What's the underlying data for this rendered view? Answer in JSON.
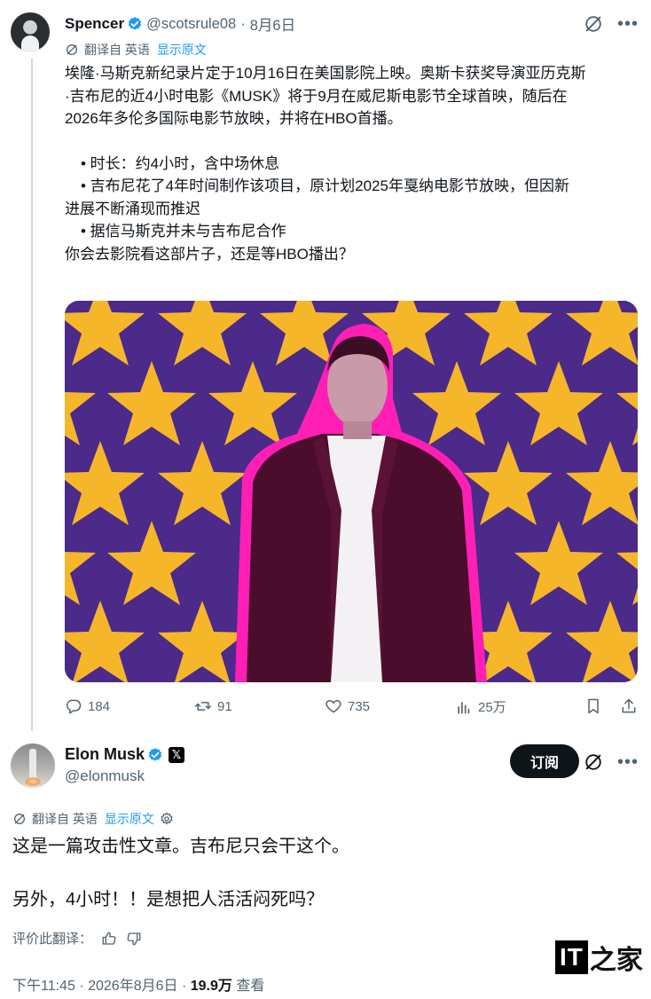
{
  "post1": {
    "name": "Spencer",
    "handle": "@scotsrule08",
    "dot": "·",
    "date": "8月6日",
    "translate_label": "翻译自 英语",
    "show_original": "显示原文",
    "body_lines": [
      "埃隆·马斯克新纪录片定于10月16日在美国影院上映。奥斯卡获奖导演亚历克斯",
      "·吉布尼的近4小时电影《MUSK》将于9月在威尼斯电影节全球首映，随后在",
      "2026年多伦多国际电影节放映，并将在HBO首播。"
    ],
    "bullets": [
      "• 时长：约4小时，含中场休息",
      "• 吉布尼花了4年时间制作该项目，原计划2025年戛纳电影节放映，但因新",
      "进展不断涌现而推迟",
      "• 据信马斯克并未与吉布尼合作"
    ],
    "question": "你会去影院看这部片子，还是等HBO播出？",
    "replies": "184",
    "reposts": "91",
    "likes": "735",
    "views": "25万"
  },
  "post2": {
    "name": "Elon Musk",
    "x_badge": "𝕏",
    "handle": "@elonmusk",
    "subscribe_label": "订阅",
    "translate_label": "翻译自 英语",
    "show_original": "显示原文",
    "para1": "这是一篇攻击性文章。吉布尼只会干这个。",
    "para2": "另外，4小时！！是想把人活活闷死吗？",
    "rate_label": "评价此翻译：",
    "time": "下午11:45",
    "dot": "·",
    "date": "2026年8月6日",
    "views": "19.9万",
    "views_label": "查看"
  },
  "watermark": {
    "it": "IT",
    "zh": "之家"
  },
  "colors": {
    "accent": "#1d9bf0",
    "muted": "#536471",
    "star": "#f6b62a",
    "purple": "#4b2a8a",
    "magenta": "#ff1fb4"
  }
}
